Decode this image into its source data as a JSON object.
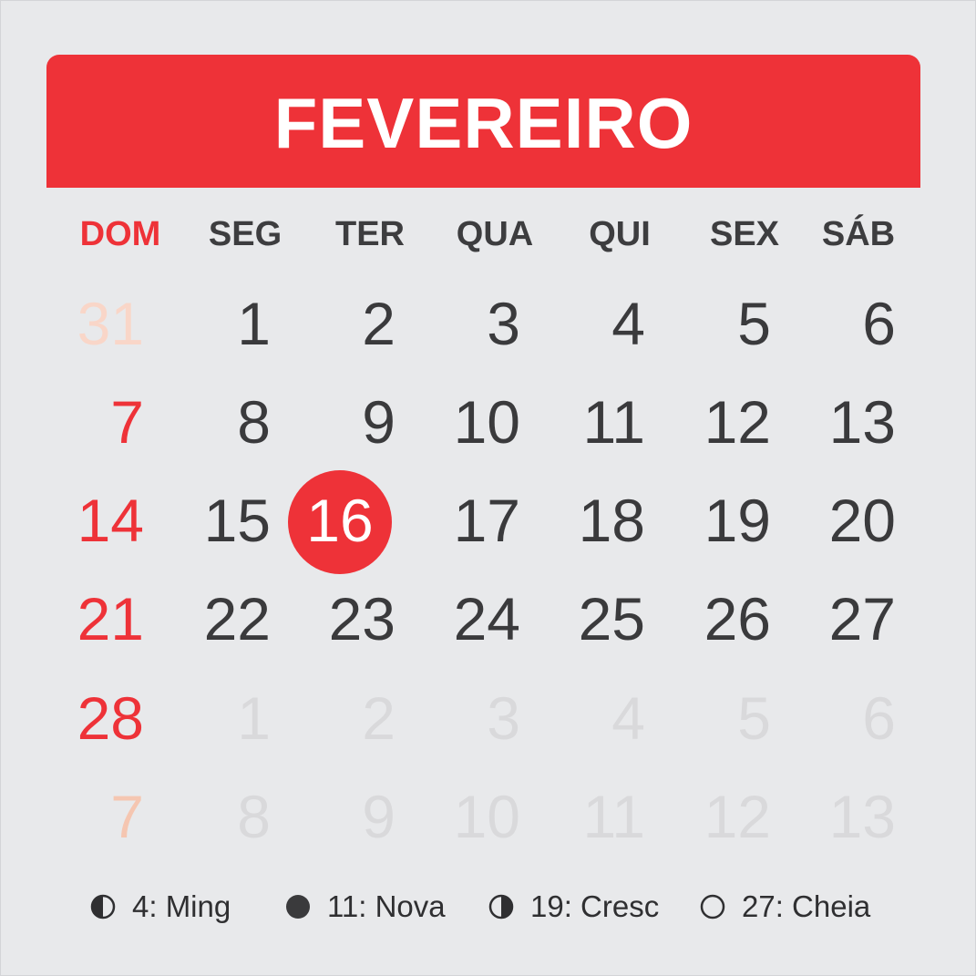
{
  "calendar": {
    "month": "FEVEREIRO",
    "weekdays": [
      "DOM",
      "SEG",
      "TER",
      "QUA",
      "QUI",
      "SEX",
      "SÁB"
    ],
    "weeks": [
      [
        "31",
        "1",
        "2",
        "3",
        "4",
        "5",
        "6"
      ],
      [
        "7",
        "8",
        "9",
        "10",
        "11",
        "12",
        "13"
      ],
      [
        "14",
        "15",
        "16",
        "17",
        "18",
        "19",
        "20"
      ],
      [
        "21",
        "22",
        "23",
        "24",
        "25",
        "26",
        "27"
      ],
      [
        "28",
        "1",
        "2",
        "3",
        "4",
        "5",
        "6"
      ],
      [
        "7",
        "8",
        "9",
        "10",
        "11",
        "12",
        "13"
      ]
    ],
    "highlighted_day": "16"
  },
  "legend": [
    {
      "icon": "moon-waning-icon",
      "label": "4: Ming"
    },
    {
      "icon": "moon-new-icon",
      "label": "11: Nova"
    },
    {
      "icon": "moon-waxing-icon",
      "label": "19: Cresc"
    },
    {
      "icon": "moon-full-icon",
      "label": "27: Cheia"
    }
  ],
  "colors": {
    "accent": "#ee3238",
    "background": "#e8e9eb",
    "text": "#3a3a3c",
    "muted": "#d9d9db"
  }
}
